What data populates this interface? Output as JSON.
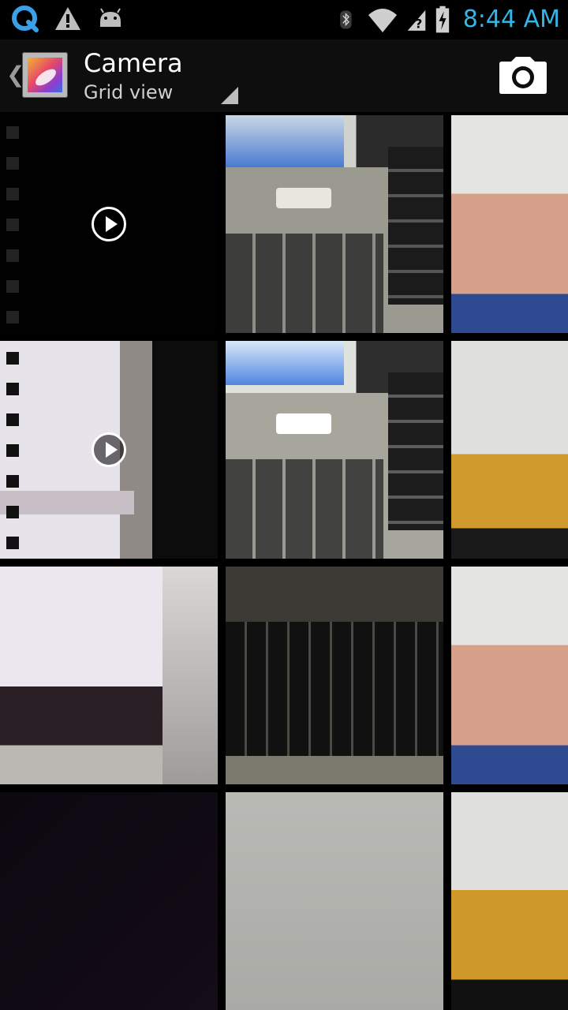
{
  "status_bar": {
    "left_icons": [
      "qik-icon",
      "warning-icon",
      "android-icon"
    ],
    "right_icons": [
      "bluetooth-icon",
      "wifi-icon",
      "no-signal-icon",
      "battery-charging-icon"
    ],
    "time": "8:44 AM",
    "time_color": "#33b5e5"
  },
  "action_bar": {
    "title": "Camera",
    "subtitle": "Grid view",
    "action_icon": "camera-icon"
  },
  "grid": {
    "rows": [
      [
        {
          "type": "video"
        },
        {
          "type": "photo"
        },
        {
          "type": "photo"
        }
      ],
      [
        {
          "type": "video"
        },
        {
          "type": "photo"
        },
        {
          "type": "photo"
        }
      ],
      [
        {
          "type": "photo"
        },
        {
          "type": "photo"
        },
        {
          "type": "photo"
        }
      ],
      [
        {
          "type": "photo"
        },
        {
          "type": "photo"
        },
        {
          "type": "photo"
        }
      ]
    ]
  }
}
